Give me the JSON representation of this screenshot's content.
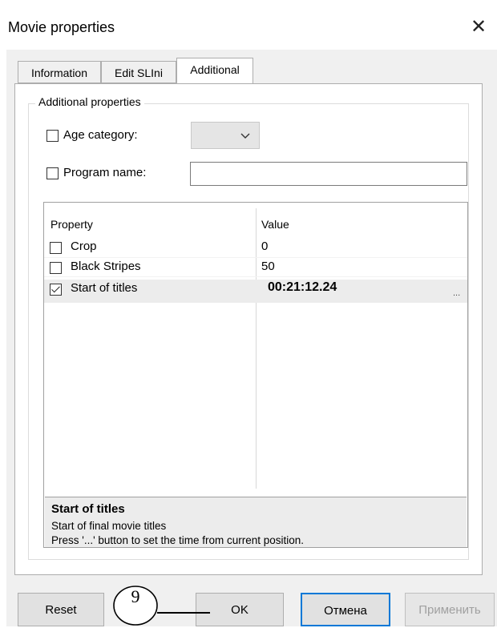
{
  "window": {
    "title": "Movie properties",
    "close_glyph": "✕"
  },
  "tabs": [
    {
      "label": "Information",
      "active": false
    },
    {
      "label": "Edit SLIni",
      "active": false
    },
    {
      "label": "Additional",
      "active": true
    }
  ],
  "group": {
    "legend": "Additional properties",
    "age_category": {
      "label": "Age category:",
      "checked": false,
      "value": ""
    },
    "program_name": {
      "label": "Program name:",
      "checked": false,
      "value": ""
    }
  },
  "grid": {
    "headers": {
      "property": "Property",
      "value": "Value"
    },
    "rows": [
      {
        "property": "Crop",
        "checked": false,
        "value": "0"
      },
      {
        "property": "Black Stripes",
        "checked": false,
        "value": "50"
      },
      {
        "property": "Start of titles",
        "checked": true,
        "value": "00:21:12.24"
      }
    ],
    "ellipsis": "..."
  },
  "description": {
    "title": "Start of titles",
    "line1": "Start of final movie titles",
    "line2": "Press '...' button to set the time from current position."
  },
  "buttons": {
    "reset": "Reset",
    "ok": "OK",
    "cancel": "Отмена",
    "apply": "Применить"
  },
  "callout": {
    "number": "9"
  }
}
